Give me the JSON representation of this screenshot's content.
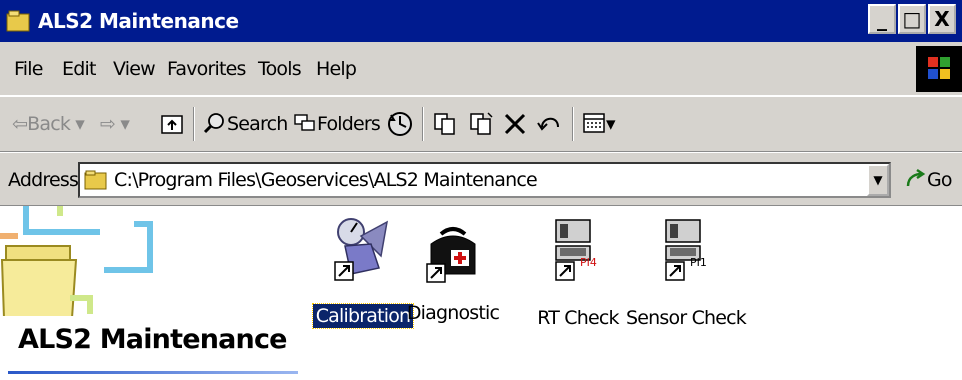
{
  "window": {
    "title": "ALS2 Maintenance",
    "minimize": "_",
    "maximize": "□",
    "close": "X"
  },
  "menu": [
    "File",
    "Edit",
    "View",
    "Favorites",
    "Tools",
    "Help"
  ],
  "toolbar": {
    "back": "Back",
    "search": "Search",
    "folders": "Folders"
  },
  "address": {
    "label": "Address",
    "value": "C:\\Program Files\\Geoservices\\ALS2 Maintenance",
    "go": "Go"
  },
  "banner": {
    "title": "ALS2 Maintenance"
  },
  "items": [
    {
      "label": "Calibration",
      "selected": true
    },
    {
      "label": "Diagnostic",
      "selected": false
    },
    {
      "label": "RT Check",
      "selected": false,
      "tag": "PI4"
    },
    {
      "label": "Sensor Check",
      "selected": false,
      "tag": "PI1"
    }
  ]
}
